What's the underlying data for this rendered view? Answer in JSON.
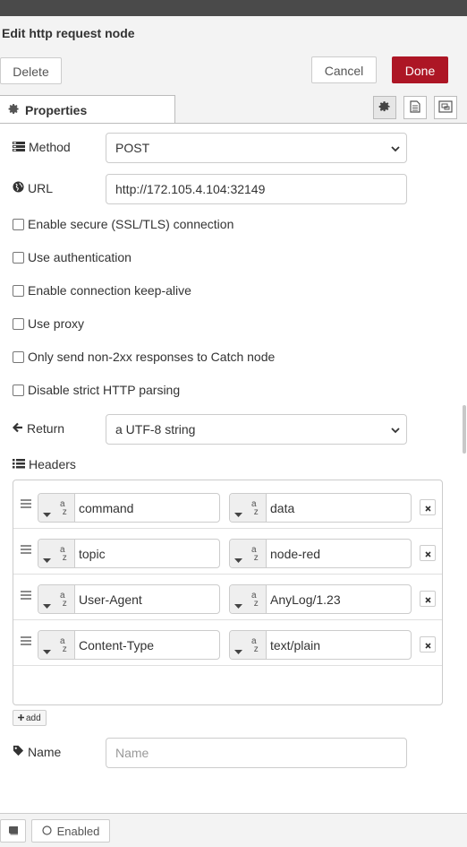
{
  "header": {
    "title": "Edit http request node"
  },
  "toolbar": {
    "delete_label": "Delete",
    "cancel_label": "Cancel",
    "done_label": "Done",
    "done_color": "#AD1625"
  },
  "tabs": {
    "properties_label": "Properties"
  },
  "form": {
    "method_label": "Method",
    "method_value": "POST",
    "url_label": "URL",
    "url_value": "http://172.105.4.104:32149",
    "checkboxes": [
      "Enable secure (SSL/TLS) connection",
      "Use authentication",
      "Enable connection keep-alive",
      "Use proxy",
      "Only send non-2xx responses to Catch node",
      "Disable strict HTTP parsing"
    ],
    "return_label": "Return",
    "return_value": "a UTF-8 string",
    "headers_label": "Headers",
    "headers": [
      {
        "name": "command",
        "value": "data"
      },
      {
        "name": "topic",
        "value": "node-red"
      },
      {
        "name": "User-Agent",
        "value": "AnyLog/1.23"
      },
      {
        "name": "Content-Type",
        "value": "text/plain"
      }
    ],
    "add_label": "add",
    "name_label": "Name",
    "name_placeholder": "Name"
  },
  "footer": {
    "enabled_label": "Enabled"
  }
}
